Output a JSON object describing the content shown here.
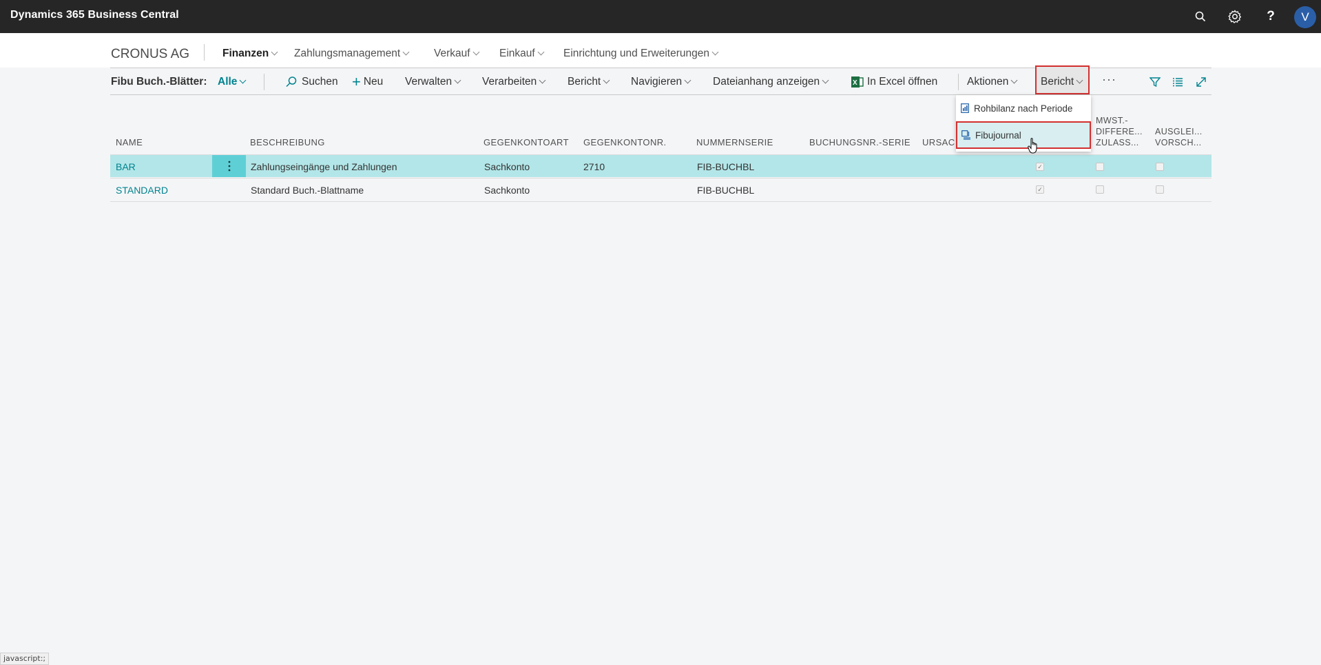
{
  "app": {
    "title": "Dynamics 365 Business Central",
    "icons": [
      "search-icon",
      "gear-icon",
      "help-icon"
    ],
    "avatar_initial": "V"
  },
  "company": "CRONUS AG",
  "nav": {
    "items": [
      "Finanzen",
      "Zahlungsmanagement",
      "Verkauf",
      "Einkauf",
      "Einrichtung und Erweiterungen"
    ]
  },
  "actionbar": {
    "caption": "Fibu Buch.-Blätter:",
    "filter": "Alle",
    "search": "Suchen",
    "new": "Neu",
    "manage": "Verwalten",
    "process": "Verarbeiten",
    "report": "Bericht",
    "navigate": "Navigieren",
    "attachment": "Dateianhang anzeigen",
    "excel": "In Excel öffnen",
    "actions": "Aktionen",
    "report2": "Bericht",
    "more": "···"
  },
  "dropdown": {
    "items": [
      "Rohbilanz nach Periode",
      "Fibujournal"
    ]
  },
  "table": {
    "headers": {
      "name": "NAME",
      "description": "BESCHREIBUNG",
      "bal_type": "GEGENKONTOART",
      "bal_no": "GEGENKONTONR.",
      "number_series": "NUMMERNSERIE",
      "posting_series": "BUCHUNGSNR.-SERIE",
      "reason": "URSAC",
      "vat_l1": "MWST.-",
      "vat_l2": "DIFFERE...",
      "vat_l3": "ZULASS...",
      "app_l1": "AUSGLEI...",
      "app_l2": "VORSCH..."
    },
    "rows": [
      {
        "name": "BAR",
        "description": "Zahlungseingänge und Zahlungen",
        "bal_type": "Sachkonto",
        "bal_no": "2710",
        "number_series": "FIB-BUCHBL",
        "check1": true,
        "check2": false,
        "check3": false
      },
      {
        "name": "STANDARD",
        "description": "Standard Buch.-Blattname",
        "bal_type": "Sachkonto",
        "bal_no": "",
        "number_series": "FIB-BUCHBL",
        "check1": true,
        "check2": false,
        "check3": false
      }
    ]
  },
  "status_bar": "javascript:;",
  "colors": {
    "accent": "#00838f",
    "selected_row": "#b3e6e8",
    "highlight": "#d32f2f",
    "appbar": "#262626"
  }
}
